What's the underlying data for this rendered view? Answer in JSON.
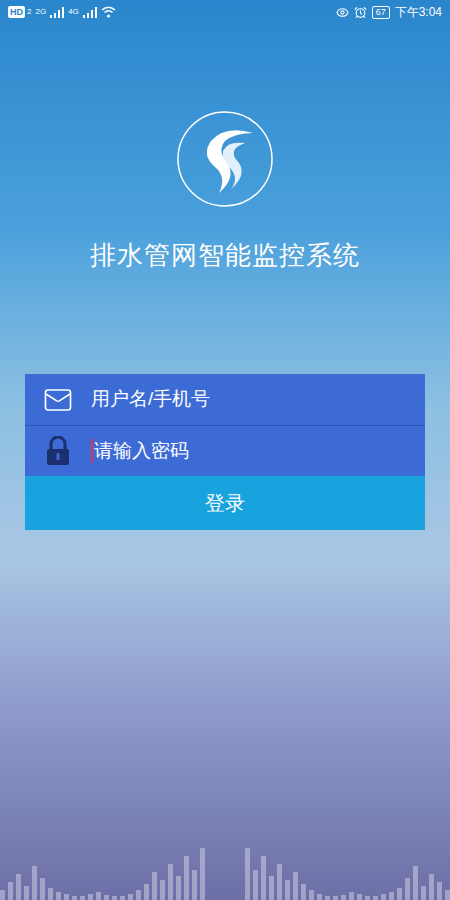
{
  "status_bar": {
    "network_badge": "HD",
    "sim_index": "2",
    "sim1_type": "2G",
    "sim2_type": "4G",
    "battery": "67",
    "time": "下午3:04"
  },
  "app": {
    "title": "排水管网智能监控系统"
  },
  "fields": [
    {
      "kind": "text",
      "placeholder": "用户名/手机号",
      "focused": false
    },
    {
      "kind": "password",
      "placeholder": "请输入密码",
      "focused": true
    }
  ],
  "buttons": [
    "登录"
  ]
}
